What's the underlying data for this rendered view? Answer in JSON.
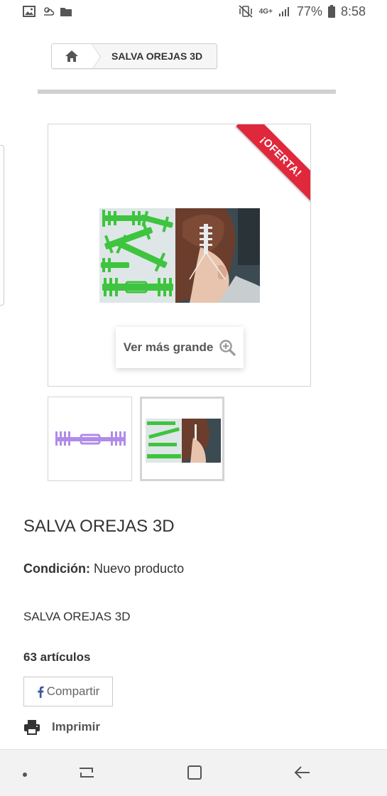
{
  "status_bar": {
    "network": "4G+",
    "battery": "77%",
    "time": "8:58"
  },
  "breadcrumb": {
    "home_icon": "home-icon",
    "current": "SALVA OREJAS 3D"
  },
  "product": {
    "badge": "¡OFERTA!",
    "view_larger_label": "Ver más grande",
    "title": "SALVA OREJAS 3D",
    "condition_label": "Condición:",
    "condition_value": "Nuevo producto",
    "short_description": "SALVA OREJAS 3D",
    "stock_text": "63 artículos"
  },
  "actions": {
    "share_label": "Compartir",
    "print_label": "Imprimir"
  },
  "colors": {
    "badge": "#e0283c",
    "product_green": "#3ec43e",
    "product_purple": "#b08ce8"
  }
}
